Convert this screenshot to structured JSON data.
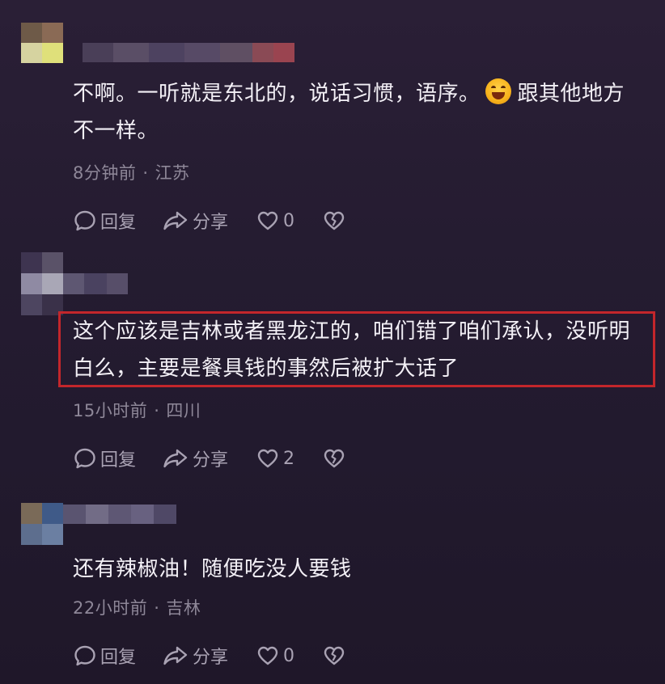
{
  "comments": [
    {
      "text_before_emoji": "不啊。一听就是东北的，说话习惯，语序。",
      "emoji": "grinning-face-emoji",
      "text_after_emoji": "跟其他地方不一样。",
      "time": "8分钟前",
      "location": "江苏",
      "actions": {
        "reply": "回复",
        "share": "分享",
        "likes": "0"
      }
    },
    {
      "text": "这个应该是吉林或者黑龙江的，咱们错了咱们承认，没听明白么，主要是餐具钱的事然后被扩大话了",
      "highlighted": true,
      "highlight_color": "#c3262b",
      "time": "15小时前",
      "location": "四川",
      "actions": {
        "reply": "回复",
        "share": "分享",
        "likes": "2"
      }
    },
    {
      "text": "还有辣椒油！随便吃没人要钱",
      "time": "22小时前",
      "location": "吉林",
      "actions": {
        "reply": "回复",
        "share": "分享",
        "likes": "0"
      }
    }
  ],
  "separator": "·",
  "colors": {
    "background": "#251c31",
    "text": "#f3f0f6",
    "meta": "#8e8798",
    "actions": "#a9a2b3"
  }
}
